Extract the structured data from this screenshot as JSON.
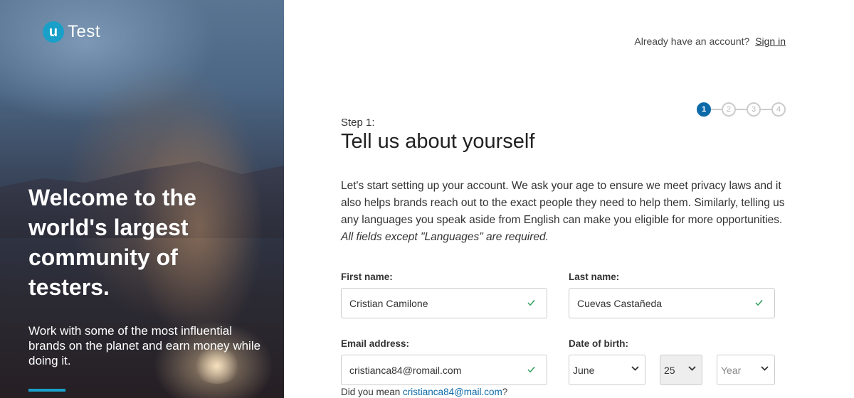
{
  "brand": {
    "logo_letter": "u",
    "logo_text": "Test",
    "accent": "#1aa0c8"
  },
  "hero": {
    "title": "Welcome to the world's largest community of testers.",
    "subtitle": "Work with some of the most influential brands on the planet and earn money while doing it."
  },
  "header": {
    "account_prompt": "Already have an account?",
    "signin_label": "Sign in"
  },
  "stepper": {
    "steps": [
      "1",
      "2",
      "3",
      "4"
    ],
    "active_index": 0,
    "active_color": "#0c6aa8"
  },
  "step": {
    "label": "Step 1:",
    "title": "Tell us about yourself",
    "intro": "Let's start setting up your account. We ask your age to ensure we meet privacy laws and it also helps brands reach out to the exact people they need to help them. Similarly, telling us any languages you speak aside from English can make you eligible for more opportunities.",
    "intro_note": "All fields except \"Languages\" are required."
  },
  "form": {
    "first_name": {
      "label": "First name:",
      "value": "Cristian Camilone"
    },
    "last_name": {
      "label": "Last name:",
      "value": "Cuevas Castañeda"
    },
    "email": {
      "label": "Email address:",
      "value": "cristianca84@romail.com"
    },
    "dob": {
      "label": "Date of birth:",
      "month": "June",
      "day": "25",
      "year_placeholder": "Year"
    },
    "email_hint": {
      "prefix": "Did you mean ",
      "suggestion": "cristianca84@mail.com",
      "suffix": "?"
    }
  },
  "colors": {
    "valid_check": "#2e9d5a"
  }
}
